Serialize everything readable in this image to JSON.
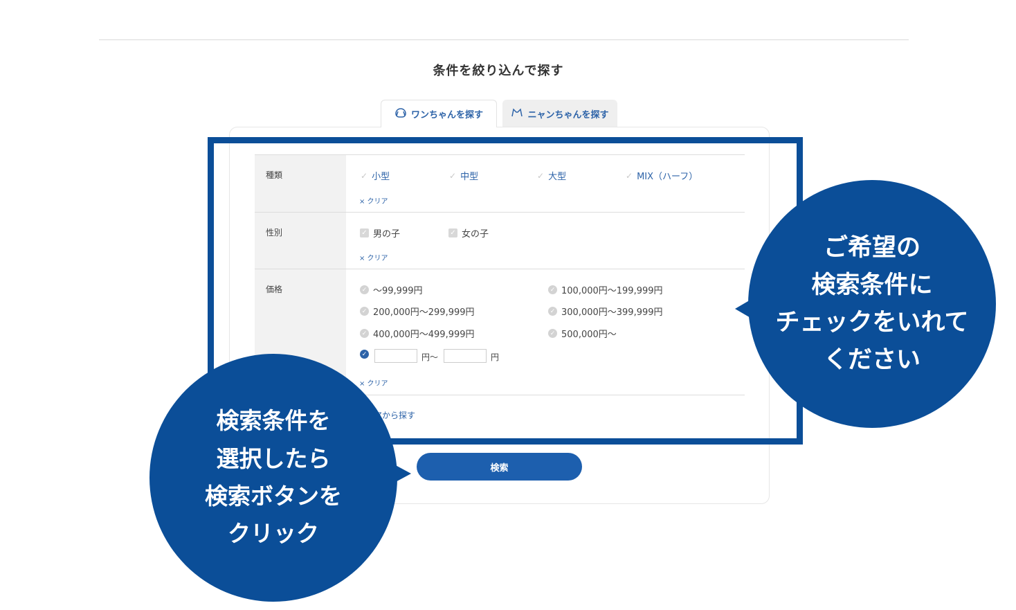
{
  "heading": "条件を絞り込んで探す",
  "tabs": [
    {
      "label": "ワンちゃんを探す",
      "icon": "dog-icon"
    },
    {
      "label": "ニャンちゃんを探す",
      "icon": "cat-icon"
    }
  ],
  "filters": {
    "breed": {
      "label": "種類",
      "options": [
        "小型",
        "中型",
        "大型",
        "MIX（ハーフ）"
      ],
      "clear": "× クリア"
    },
    "gender": {
      "label": "性別",
      "options": [
        "男の子",
        "女の子"
      ],
      "clear": "× クリア"
    },
    "price": {
      "label": "価格",
      "options": [
        "～99,999円",
        "100,000円～199,999円",
        "200,000円～299,999円",
        "300,000円～399,999円",
        "400,000円～499,999円",
        "500,000円～"
      ],
      "custom_from_unit": "円～",
      "custom_to_unit": "円",
      "clear": "× クリア"
    }
  },
  "area_link": "アから探す",
  "search_button": "検索",
  "callouts": {
    "right": [
      "ご希望の",
      "検索条件に",
      "チェックをいれて",
      "ください"
    ],
    "left": [
      "検索条件を",
      "選択したら",
      "検索ボタンを",
      "クリック"
    ]
  },
  "colors": {
    "brand_blue": "#0b4e98",
    "button_blue": "#1d5fae",
    "link_blue": "#2d63a8"
  }
}
